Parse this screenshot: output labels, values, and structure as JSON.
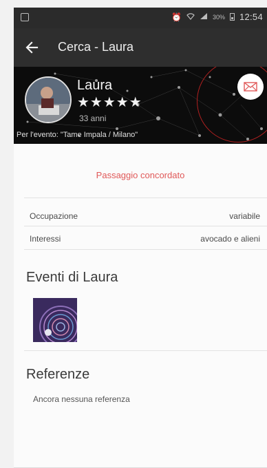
{
  "status_bar": {
    "time": "12:54",
    "battery": "30%"
  },
  "toolbar": {
    "title": "Cerca - Laura"
  },
  "profile": {
    "name": "Laura",
    "stars": "★★★★★",
    "age": "33 anni",
    "event": "Per l'evento: \"Tame Impala / Milano\""
  },
  "ride_status": "Passaggio concordato",
  "info_rows": [
    {
      "label": "Occupazione",
      "value": "variabile"
    },
    {
      "label": "Interessi",
      "value": "avocado e alieni"
    }
  ],
  "events_section": {
    "title": "Eventi di  Laura"
  },
  "references_section": {
    "title": "Referenze",
    "empty_text": "Ancora nessuna referenza"
  },
  "icons": {
    "back": "arrow-left-icon",
    "message": "envelope-icon",
    "wifi": "wifi-icon",
    "signal": "signal-icon",
    "alarm": "alarm-icon"
  },
  "colors": {
    "status_text": "#e05858",
    "envelope": "#e05858",
    "toolbar": "#2e2e2e",
    "highlight_ring": "#b12020"
  }
}
